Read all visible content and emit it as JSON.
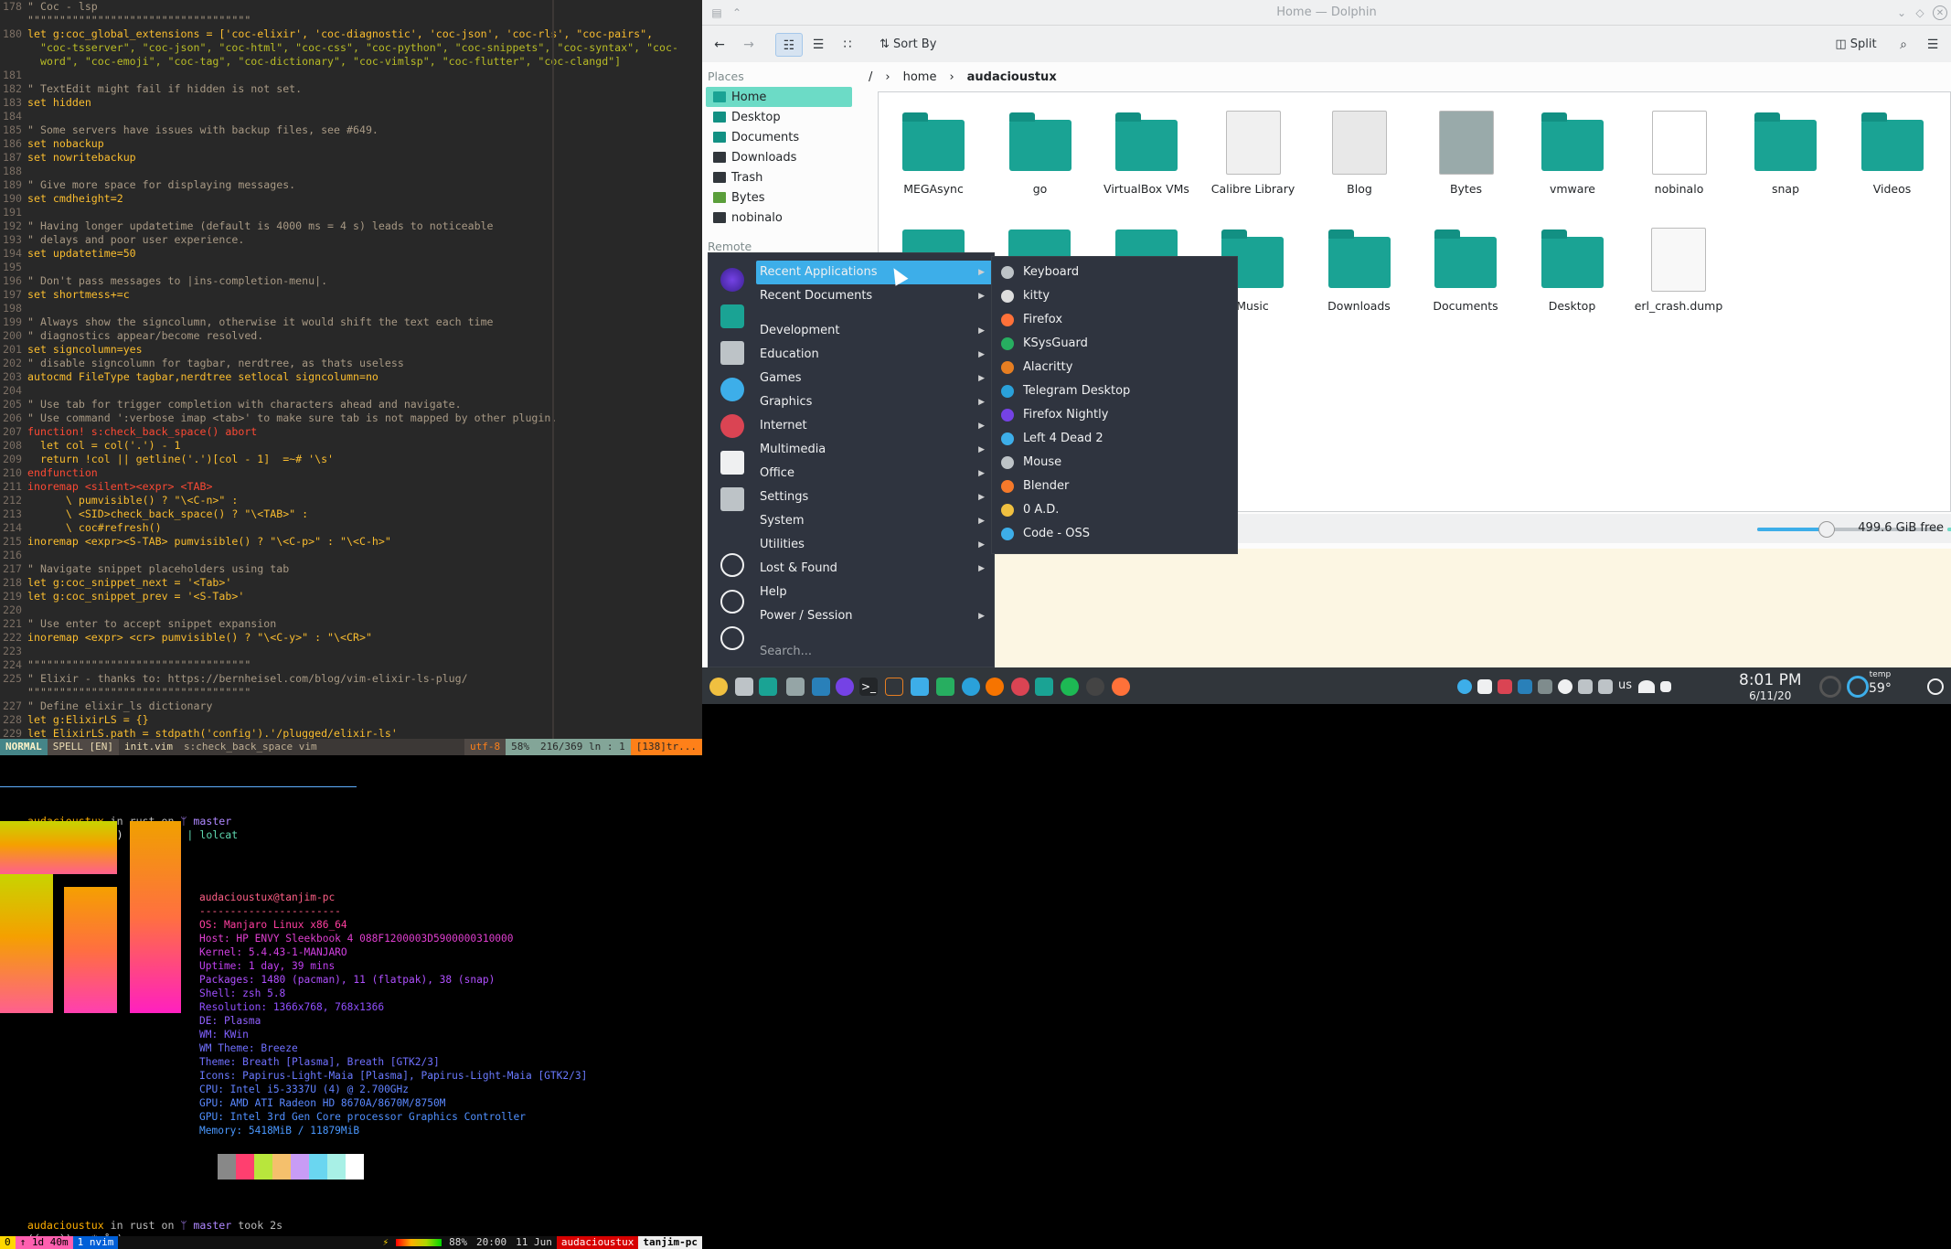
{
  "vim": {
    "lines": [
      {
        "n": "178",
        "t": "\" Coc - lsp",
        "c": "c"
      },
      {
        "n": "",
        "t": "\"\"\"\"\"\"\"\"\"\"\"\"\"\"\"\"\"\"\"\"\"\"\"\"\"\"\"\"\"\"\"\"\"\"\"",
        "c": "c"
      },
      {
        "n": "180",
        "t": "let g:coc_global_extensions = ['coc-elixir', 'coc-diagnostic', 'coc-json', 'coc-rls', \"coc-pairs\",",
        "c": "y"
      },
      {
        "n": "",
        "t": "  \"coc-tsserver\", \"coc-json\", \"coc-html\", \"coc-css\", \"coc-python\", \"coc-snippets\", \"coc-syntax\", \"coc-",
        "c": "s"
      },
      {
        "n": "",
        "t": "  word\", \"coc-emoji\", \"coc-tag\", \"coc-dictionary\", \"coc-vimlsp\", \"coc-flutter\", \"coc-clangd\"]",
        "c": "s"
      },
      {
        "n": "181",
        "t": "",
        "c": "w"
      },
      {
        "n": "182",
        "t": "\" TextEdit might fail if hidden is not set.",
        "c": "c"
      },
      {
        "n": "183",
        "t": "set hidden",
        "c": "y"
      },
      {
        "n": "184",
        "t": "",
        "c": "w"
      },
      {
        "n": "185",
        "t": "\" Some servers have issues with backup files, see #649.",
        "c": "c"
      },
      {
        "n": "186",
        "t": "set nobackup",
        "c": "y"
      },
      {
        "n": "187",
        "t": "set nowritebackup",
        "c": "y"
      },
      {
        "n": "188",
        "t": "",
        "c": "w"
      },
      {
        "n": "189",
        "t": "\" Give more space for displaying messages.",
        "c": "c"
      },
      {
        "n": "190",
        "t": "set cmdheight=2",
        "c": "y"
      },
      {
        "n": "191",
        "t": "",
        "c": "w"
      },
      {
        "n": "192",
        "t": "\" Having longer updatetime (default is 4000 ms = 4 s) leads to noticeable",
        "c": "c"
      },
      {
        "n": "193",
        "t": "\" delays and poor user experience.",
        "c": "c"
      },
      {
        "n": "194",
        "t": "set updatetime=50",
        "c": "y"
      },
      {
        "n": "195",
        "t": "",
        "c": "w"
      },
      {
        "n": "196",
        "t": "\" Don't pass messages to |ins-completion-menu|.",
        "c": "c"
      },
      {
        "n": "197",
        "t": "set shortmess+=c",
        "c": "y"
      },
      {
        "n": "198",
        "t": "",
        "c": "w"
      },
      {
        "n": "199",
        "t": "\" Always show the signcolumn, otherwise it would shift the text each time",
        "c": "c"
      },
      {
        "n": "200",
        "t": "\" diagnostics appear/become resolved.",
        "c": "c"
      },
      {
        "n": "201",
        "t": "set signcolumn=yes",
        "c": "y"
      },
      {
        "n": "202",
        "t": "\" disable signcolumn for tagbar, nerdtree, as thats useless",
        "c": "c"
      },
      {
        "n": "203",
        "t": "autocmd FileType tagbar,nerdtree setlocal signcolumn=no",
        "c": "y"
      },
      {
        "n": "204",
        "t": "",
        "c": "w"
      },
      {
        "n": "205",
        "t": "\" Use tab for trigger completion with characters ahead and navigate.",
        "c": "c"
      },
      {
        "n": "206",
        "t": "\" Use command ':verbose imap <tab>' to make sure tab is not mapped by other plugin.",
        "c": "c"
      },
      {
        "n": "207",
        "t": "function! s:check_back_space() abort",
        "c": "k"
      },
      {
        "n": "208",
        "t": "  let col = col('.') - 1",
        "c": "y"
      },
      {
        "n": "209",
        "t": "  return !col || getline('.')[col - 1]  =~# '\\s'",
        "c": "y"
      },
      {
        "n": "210",
        "t": "endfunction",
        "c": "k"
      },
      {
        "n": "211",
        "t": "inoremap <silent><expr> <TAB>",
        "c": "k"
      },
      {
        "n": "212",
        "t": "      \\ pumvisible() ? \"\\<C-n>\" :",
        "c": "y"
      },
      {
        "n": "213",
        "t": "      \\ <SID>check_back_space() ? \"\\<TAB>\" :",
        "c": "y"
      },
      {
        "n": "214",
        "t": "      \\ coc#refresh()",
        "c": "y"
      },
      {
        "n": "215",
        "t": "inoremap <expr><S-TAB> pumvisible() ? \"\\<C-p>\" : \"\\<C-h>\"",
        "c": "y"
      },
      {
        "n": "216",
        "t": "",
        "c": "w"
      },
      {
        "n": "217",
        "t": "\" Navigate snippet placeholders using tab",
        "c": "c"
      },
      {
        "n": "218",
        "t": "let g:coc_snippet_next = '<Tab>'",
        "c": "y"
      },
      {
        "n": "219",
        "t": "let g:coc_snippet_prev = '<S-Tab>'",
        "c": "y"
      },
      {
        "n": "220",
        "t": "",
        "c": "w"
      },
      {
        "n": "221",
        "t": "\" Use enter to accept snippet expansion",
        "c": "c"
      },
      {
        "n": "222",
        "t": "inoremap <expr> <cr> pumvisible() ? \"\\<C-y>\" : \"\\<CR>\"",
        "c": "y"
      },
      {
        "n": "223",
        "t": "",
        "c": "w"
      },
      {
        "n": "224",
        "t": "\"\"\"\"\"\"\"\"\"\"\"\"\"\"\"\"\"\"\"\"\"\"\"\"\"\"\"\"\"\"\"\"\"\"\"",
        "c": "c"
      },
      {
        "n": "225",
        "t": "\" Elixir - thanks to: https://bernheisel.com/blog/vim-elixir-ls-plug/",
        "c": "c"
      },
      {
        "n": "",
        "t": "\"\"\"\"\"\"\"\"\"\"\"\"\"\"\"\"\"\"\"\"\"\"\"\"\"\"\"\"\"\"\"\"\"\"\"",
        "c": "c"
      },
      {
        "n": "227",
        "t": "\" Define elixir_ls dictionary",
        "c": "c"
      },
      {
        "n": "228",
        "t": "let g:ElixirLS = {}",
        "c": "y"
      },
      {
        "n": "229",
        "t": "let ElixirLS.path = stdpath('config').'/plugged/elixir-ls'",
        "c": "y"
      }
    ],
    "status": {
      "mode": "NORMAL",
      "spell": "SPELL [EN]",
      "file": "init.vim",
      "func": "s:check_back_space  vim",
      "encoding": "utf-8",
      "percent": "58%",
      "position": "216/369 ln :  1",
      "warnings": "[138]tr..."
    }
  },
  "terminal": {
    "prompt1_user": "audacioustux",
    "prompt1_rest": " in rust on ",
    "prompt1_branch": "master",
    "prompt1_face": "(´ - `)>⌒.*.˚ )",
    "prompt1_cmd": "neofetch | lolcat",
    "info": [
      {
        "t": "audacioustux@tanjim-pc",
        "c": "#ff5f87"
      },
      {
        "t": "-----------------------",
        "c": "#ff5f87"
      },
      {
        "t": "OS: Manjaro Linux x86_64",
        "c": "#ff3f9f"
      },
      {
        "t": "Host: HP ENVY Sleekbook 4 088F1200003D5900000310000",
        "c": "#e03fd0"
      },
      {
        "t": "Kernel: 5.4.43-1-MANJARO",
        "c": "#d040e0"
      },
      {
        "t": "Uptime: 1 day, 39 mins",
        "c": "#c040f0"
      },
      {
        "t": "Packages: 1480 (pacman), 11 (flatpak), 38 (snap)",
        "c": "#b050ff"
      },
      {
        "t": "Shell: zsh 5.8",
        "c": "#a050ff"
      },
      {
        "t": "Resolution: 1366x768, 768x1366",
        "c": "#9050ff"
      },
      {
        "t": "DE: Plasma",
        "c": "#9060ff"
      },
      {
        "t": "WM: KWin",
        "c": "#8060ff"
      },
      {
        "t": "WM Theme: Breeze",
        "c": "#7070ff"
      },
      {
        "t": "Theme: Breath [Plasma], Breath [GTK2/3]",
        "c": "#7070ff"
      },
      {
        "t": "Icons: Papirus-Light-Maia [Plasma], Papirus-Light-Maia [GTK2/3]",
        "c": "#6a7aff"
      },
      {
        "t": "CPU: Intel i5-3337U (4) @ 2.700GHz",
        "c": "#6080ff"
      },
      {
        "t": "GPU: AMD ATI Radeon HD 8670A/8670M/8750M",
        "c": "#5a88ff"
      },
      {
        "t": "GPU: Intel 3rd Gen Core processor Graphics Controller",
        "c": "#5090ff"
      },
      {
        "t": "Memory: 5418MiB / 11879MiB",
        "c": "#4a98ff"
      }
    ],
    "prompt2_user": "audacioustux",
    "prompt2_rest": " in rust on ",
    "prompt2_branch": "master",
    "prompt2_took": " took 2s",
    "prompt2_face": "(´ - `)>⌒.*.˚ )",
    "tmux": {
      "session": "0",
      "uptime": "↑ 1d 40m",
      "window": "1 nvim",
      "battery": "88%",
      "time": "20:00",
      "date": "11 Jun",
      "user": "audacioustux",
      "host": "tanjim-pc"
    },
    "palette": [
      "#000000",
      "#888888",
      "#ff3f6f",
      "#b8e63c",
      "#f5c06c",
      "#c89cf5",
      "#6ad6f0",
      "#a8f0e6",
      "#ffffff"
    ]
  },
  "dolphin": {
    "title": "Home — Dolphin",
    "sort_label": "Sort By",
    "split_label": "Split",
    "places_header": "Places",
    "places": [
      {
        "label": "Home",
        "color": "#1aa394",
        "selected": true
      },
      {
        "label": "Desktop",
        "color": "#129083",
        "selected": false
      },
      {
        "label": "Documents",
        "color": "#129083",
        "selected": false
      },
      {
        "label": "Downloads",
        "color": "#31363b",
        "selected": false
      },
      {
        "label": "Trash",
        "color": "#31363b",
        "selected": false
      },
      {
        "label": "Bytes",
        "color": "#5a9e3a",
        "selected": false
      },
      {
        "label": "nobinalo",
        "color": "#31363b",
        "selected": false
      }
    ],
    "remote_header": "Remote",
    "crumbs": {
      "root": "/",
      "home": "home",
      "current": "audacioustux"
    },
    "files_row1": [
      "MEGAsync",
      "go",
      "VirtualBox VMs",
      "Calibre Library",
      "Blog",
      "Bytes",
      "vmware",
      "nobinalo",
      "snap",
      "Videos"
    ],
    "files_row2": [
      "Music",
      "Downloads",
      "Documents",
      "Desktop",
      "erl_crash.dump"
    ],
    "free_space": "499.6 GiB free",
    "zoom_level": 0.38,
    "space_used": 0.18
  },
  "kickoff": {
    "categories": [
      {
        "label": "Recent Applications",
        "highlight": true
      },
      {
        "label": "Recent Documents",
        "highlight": false
      },
      {
        "label": "Development",
        "highlight": false
      },
      {
        "label": "Education",
        "highlight": false
      },
      {
        "label": "Games",
        "highlight": false
      },
      {
        "label": "Graphics",
        "highlight": false
      },
      {
        "label": "Internet",
        "highlight": false
      },
      {
        "label": "Multimedia",
        "highlight": false
      },
      {
        "label": "Office",
        "highlight": false
      },
      {
        "label": "Settings",
        "highlight": false
      },
      {
        "label": "System",
        "highlight": false
      },
      {
        "label": "Utilities",
        "highlight": false
      },
      {
        "label": "Lost & Found",
        "highlight": false
      },
      {
        "label": "Help",
        "highlight": false
      },
      {
        "label": "Power / Session",
        "highlight": false
      }
    ],
    "search_placeholder": "Search...",
    "recent_apps": [
      {
        "label": "Keyboard",
        "color": "#bdc3c7"
      },
      {
        "label": "kitty",
        "color": "#ddd"
      },
      {
        "label": "Firefox",
        "color": "#ff7139"
      },
      {
        "label": "KSysGuard",
        "color": "#27ae60"
      },
      {
        "label": "Alacritty",
        "color": "#e67e22"
      },
      {
        "label": "Telegram Desktop",
        "color": "#2aa1da"
      },
      {
        "label": "Firefox Nightly",
        "color": "#7542e5"
      },
      {
        "label": "Left 4 Dead 2",
        "color": "#3daee9"
      },
      {
        "label": "Mouse",
        "color": "#bdc3c7"
      },
      {
        "label": "Blender",
        "color": "#f5792a"
      },
      {
        "label": "0 A.D.",
        "color": "#f0c040"
      },
      {
        "label": "Code - OSS",
        "color": "#3daee9"
      }
    ]
  },
  "taskbar": {
    "time": "8:01 PM",
    "date": "6/11/20",
    "layout": "us",
    "weather_label": "temp",
    "weather_value": "59°"
  }
}
